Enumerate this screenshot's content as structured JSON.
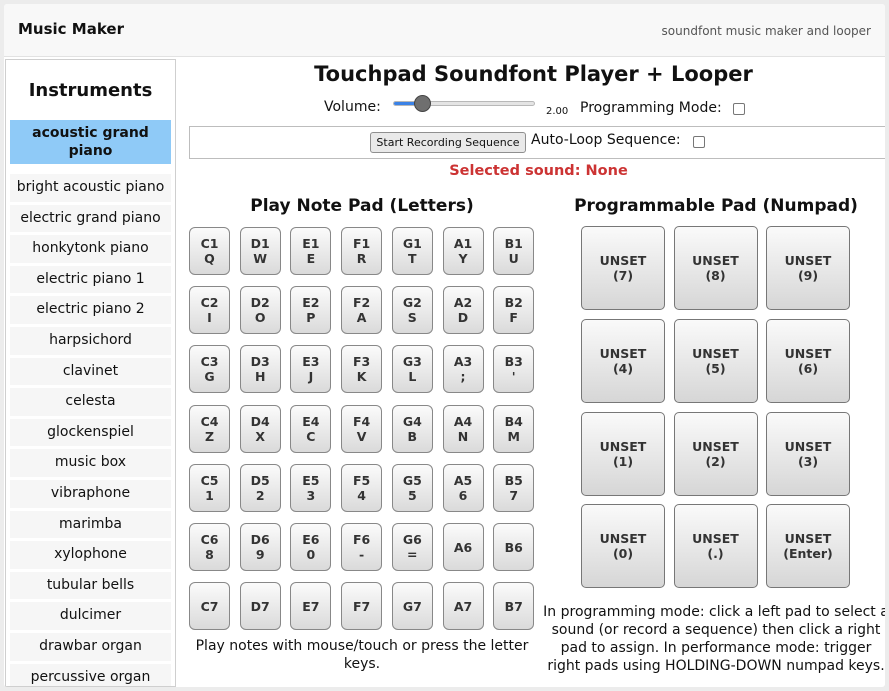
{
  "header": {
    "title": "Music Maker",
    "subtitle": "soundfont music maker and looper"
  },
  "sidebar": {
    "title": "Instruments",
    "selected_index": 0,
    "items": [
      "acoustic grand piano",
      "bright acoustic piano",
      "electric grand piano",
      "honkytonk piano",
      "electric piano 1",
      "electric piano 2",
      "harpsichord",
      "clavinet",
      "celesta",
      "glockenspiel",
      "music box",
      "vibraphone",
      "marimba",
      "xylophone",
      "tubular bells",
      "dulcimer",
      "drawbar organ",
      "percussive organ"
    ]
  },
  "main": {
    "title": "Touchpad Soundfont Player + Looper",
    "volume_label": "Volume:",
    "volume_value": "2.00",
    "volume_fraction": 0.25,
    "programming_mode_label": "Programming Mode:",
    "programming_mode_checked": false,
    "record_button_label": "Start Recording Sequence",
    "autoloop_label": "Auto-Loop Sequence:",
    "autoloop_checked": false,
    "selected_sound": "Selected sound: None",
    "accent_color": "#3b82e6",
    "selected_color": "#8fcaf7",
    "warning_color": "#cc3333"
  },
  "note_pad": {
    "title": "Play Note Pad (Letters)",
    "rows": [
      [
        [
          "C1",
          "Q"
        ],
        [
          "D1",
          "W"
        ],
        [
          "E1",
          "E"
        ],
        [
          "F1",
          "R"
        ],
        [
          "G1",
          "T"
        ],
        [
          "A1",
          "Y"
        ],
        [
          "B1",
          "U"
        ]
      ],
      [
        [
          "C2",
          "I"
        ],
        [
          "D2",
          "O"
        ],
        [
          "E2",
          "P"
        ],
        [
          "F2",
          "A"
        ],
        [
          "G2",
          "S"
        ],
        [
          "A2",
          "D"
        ],
        [
          "B2",
          "F"
        ]
      ],
      [
        [
          "C3",
          "G"
        ],
        [
          "D3",
          "H"
        ],
        [
          "E3",
          "J"
        ],
        [
          "F3",
          "K"
        ],
        [
          "G3",
          "L"
        ],
        [
          "A3",
          ";"
        ],
        [
          "B3",
          "'"
        ]
      ],
      [
        [
          "C4",
          "Z"
        ],
        [
          "D4",
          "X"
        ],
        [
          "E4",
          "C"
        ],
        [
          "F4",
          "V"
        ],
        [
          "G4",
          "B"
        ],
        [
          "A4",
          "N"
        ],
        [
          "B4",
          "M"
        ]
      ],
      [
        [
          "C5",
          "1"
        ],
        [
          "D5",
          "2"
        ],
        [
          "E5",
          "3"
        ],
        [
          "F5",
          "4"
        ],
        [
          "G5",
          "5"
        ],
        [
          "A5",
          "6"
        ],
        [
          "B5",
          "7"
        ]
      ],
      [
        [
          "C6",
          "8"
        ],
        [
          "D6",
          "9"
        ],
        [
          "E6",
          "0"
        ],
        [
          "F6",
          "-"
        ],
        [
          "G6",
          "="
        ],
        [
          "A6",
          ""
        ],
        [
          "B6",
          ""
        ]
      ],
      [
        [
          "C7",
          ""
        ],
        [
          "D7",
          ""
        ],
        [
          "E7",
          ""
        ],
        [
          "F7",
          ""
        ],
        [
          "G7",
          ""
        ],
        [
          "A7",
          ""
        ],
        [
          "B7",
          ""
        ]
      ]
    ],
    "help": "Play notes with mouse/touch or press the letter keys."
  },
  "prog_pad": {
    "title": "Programmable Pad (Numpad)",
    "pads": [
      [
        [
          "UNSET",
          "(7)"
        ],
        [
          "UNSET",
          "(8)"
        ],
        [
          "UNSET",
          "(9)"
        ]
      ],
      [
        [
          "UNSET",
          "(4)"
        ],
        [
          "UNSET",
          "(5)"
        ],
        [
          "UNSET",
          "(6)"
        ]
      ],
      [
        [
          "UNSET",
          "(1)"
        ],
        [
          "UNSET",
          "(2)"
        ],
        [
          "UNSET",
          "(3)"
        ]
      ],
      [
        [
          "UNSET",
          "(0)"
        ],
        [
          "UNSET",
          "(.)"
        ],
        [
          "UNSET",
          "(Enter)"
        ]
      ]
    ],
    "help": "In programming mode: click a left pad to select a sound (or record a sequence) then click a right pad to assign. In performance mode: trigger right pads using HOLDING-DOWN numpad keys."
  }
}
